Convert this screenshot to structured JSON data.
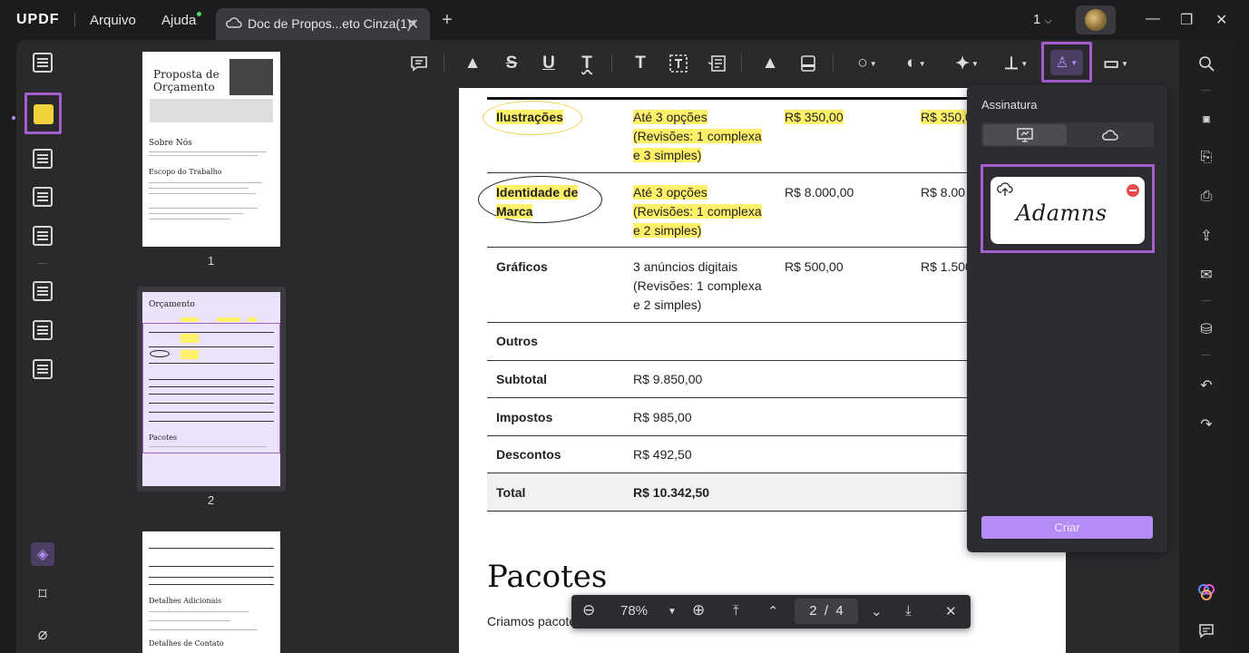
{
  "app": {
    "logo": "UPDF",
    "menu": [
      "Arquivo",
      "Ajuda"
    ],
    "tab_title": "Doc de Propos...eto Cinza(1)*",
    "page_indicator": "1"
  },
  "thumbnails": [
    {
      "number": "1",
      "title": "Proposta de Orçamento",
      "h1": "Sobre Nós",
      "h2": "Escopo do Trabalho"
    },
    {
      "number": "2",
      "title": "Orçamento",
      "h1": "Pacotes"
    },
    {
      "number": "",
      "h1": "Detalhes Adicionais",
      "h2": "Detalhes de Contato"
    }
  ],
  "table": {
    "rows": [
      {
        "item": "Ilustrações",
        "desc": [
          "Até 3 opções",
          "(Revisões: 1 complexa",
          "e 3 simples)"
        ],
        "price": "R$ 350,00",
        "total": "R$ 350,0",
        "highlight": true
      },
      {
        "item": "Identidade de Marca",
        "item_lines": [
          "Identidade de",
          "Marca"
        ],
        "desc": [
          "Até 3 opções",
          "(Revisões: 1 complexa",
          "e 2 simples)"
        ],
        "price": "R$ 8.000,00",
        "total": "R$ 8.00",
        "highlight": true
      },
      {
        "item": "Gráficos",
        "desc": [
          "3 anúncios digitais",
          "(Revisões: 1 complexa",
          "e 2 simples)"
        ],
        "price": "R$ 500,00",
        "total": "R$ 1.500",
        "highlight": false
      },
      {
        "item": "Outros",
        "desc": [],
        "price": "",
        "total": ""
      },
      {
        "item": "Subtotal",
        "desc": [
          "R$ 9.850,00"
        ]
      },
      {
        "item": "Impostos",
        "desc": [
          "R$ 985,00"
        ]
      },
      {
        "item": "Descontos",
        "desc": [
          "R$ 492,50"
        ]
      },
      {
        "item": "Total",
        "desc": [
          "R$ 10.342,50"
        ]
      }
    ]
  },
  "page": {
    "heading": "Pacotes",
    "body_start": "Criamos pacote"
  },
  "zoom": {
    "level": "78%",
    "current_page": "2",
    "separator": "/",
    "total_pages": "4"
  },
  "signature_panel": {
    "title": "Assinatura",
    "signature_text": "Adamns",
    "create_label": "Criar"
  },
  "colors": {
    "accent": "#a45ecf",
    "highlight": "#fff06a",
    "create_button": "#b58cf5"
  }
}
